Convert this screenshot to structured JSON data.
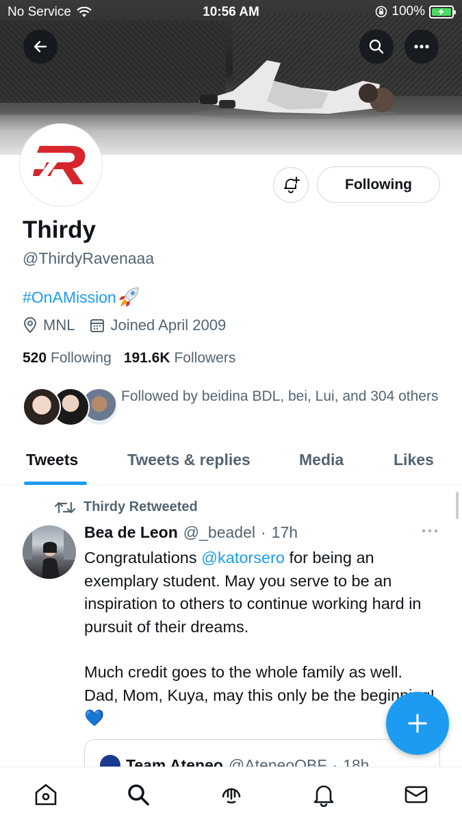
{
  "status_bar": {
    "carrier": "No Service",
    "time": "10:56 AM",
    "battery": "100%"
  },
  "header": {
    "back_icon": "arrow-left-icon",
    "search_icon": "search-icon",
    "more_icon": "more-horizontal-icon"
  },
  "profile": {
    "name": "Thirdy",
    "handle": "@ThirdyRavenaaa",
    "bio": "#OnAMission",
    "location": "MNL",
    "joined": "Joined April 2009",
    "following_count": "520",
    "following_label": "Following",
    "followers_count": "191.6K",
    "followers_label": "Followers",
    "followed_by": "Followed by beidina BDL, bei, Lui, and 304 others",
    "follow_button": "Following",
    "accent": "#d6262c"
  },
  "tabs": [
    {
      "label": "Tweets",
      "active": true
    },
    {
      "label": "Tweets & replies",
      "active": false
    },
    {
      "label": "Media",
      "active": false
    },
    {
      "label": "Likes",
      "active": false
    }
  ],
  "tweet": {
    "retweet_label": "Thirdy Retweeted",
    "author": "Bea de Leon",
    "handle": "@_beadel",
    "dot": "·",
    "time": "17h",
    "text_before_mention": "Congratulations ",
    "mention": "@katorsero",
    "text_after_mention": " for being an exemplary student. May you serve to be an inspiration to others to continue working hard in pursuit of their dreams.",
    "text_para2": "Much credit goes to the whole family as well. Dad, Mom, Kuya, may this only be the beginning! 💙",
    "quote": {
      "author": "Team Ateneo",
      "handle": "@AteneoOBF",
      "time": "18h"
    }
  },
  "bottom_nav": [
    "home-icon",
    "search-icon",
    "spaces-icon",
    "notifications-icon",
    "messages-icon"
  ],
  "colors": {
    "link": "#1d9bf0",
    "muted": "#536471",
    "text": "#0f1419"
  }
}
